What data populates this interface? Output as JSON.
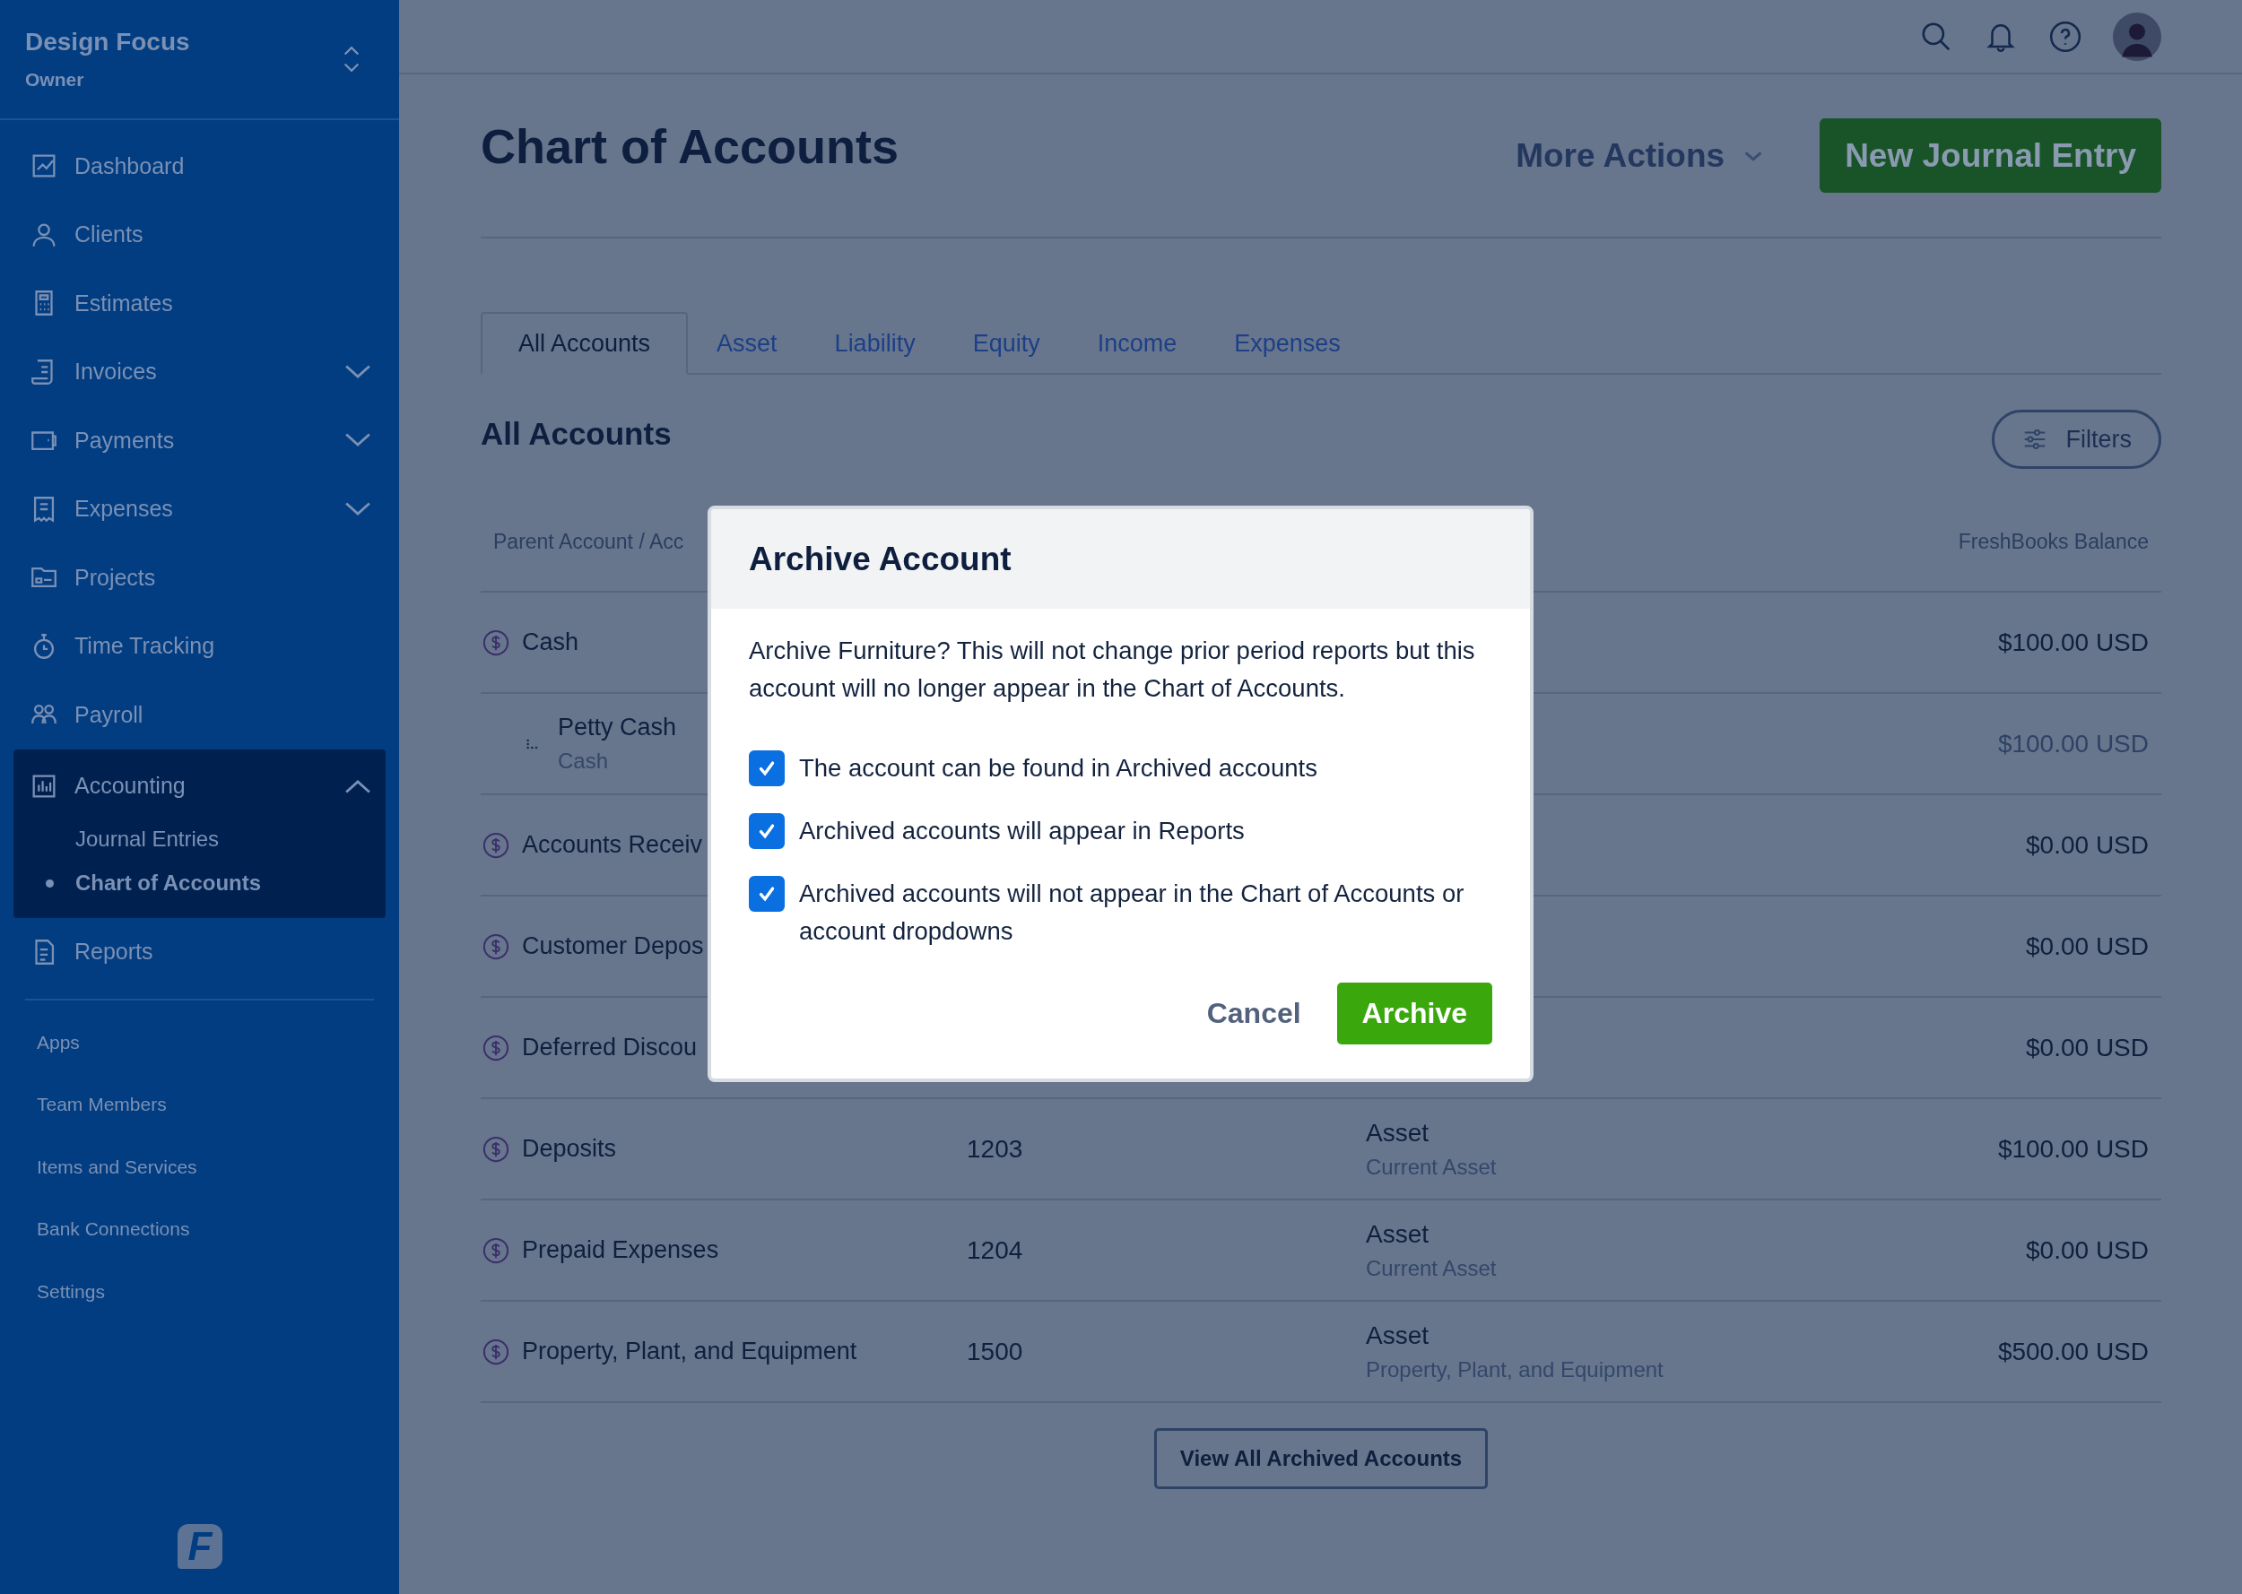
{
  "workspace": {
    "name": "Design Focus",
    "role": "Owner"
  },
  "nav": [
    {
      "label": "Dashboard",
      "kind": "link"
    },
    {
      "label": "Clients",
      "kind": "link"
    },
    {
      "label": "Estimates",
      "kind": "link"
    },
    {
      "label": "Invoices",
      "kind": "group",
      "expanded": false
    },
    {
      "label": "Payments",
      "kind": "group",
      "expanded": false
    },
    {
      "label": "Expenses",
      "kind": "group",
      "expanded": false
    },
    {
      "label": "Projects",
      "kind": "link"
    },
    {
      "label": "Time Tracking",
      "kind": "link"
    },
    {
      "label": "Payroll",
      "kind": "link"
    },
    {
      "label": "Accounting",
      "kind": "group",
      "expanded": true,
      "children": [
        {
          "label": "Journal Entries",
          "selected": false
        },
        {
          "label": "Chart of Accounts",
          "selected": true
        }
      ]
    },
    {
      "label": "Reports",
      "kind": "link"
    }
  ],
  "secondary_nav": [
    "Apps",
    "Team Members",
    "Items and Services",
    "Bank Connections",
    "Settings"
  ],
  "logo": {
    "letter": "F"
  },
  "page": {
    "title": "Chart of Accounts",
    "more_actions": "More Actions",
    "primary_button": "New Journal Entry"
  },
  "tabs": [
    {
      "label": "All Accounts",
      "selected": true
    },
    {
      "label": "Asset",
      "selected": false
    },
    {
      "label": "Liability",
      "selected": false
    },
    {
      "label": "Equity",
      "selected": false
    },
    {
      "label": "Income",
      "selected": false
    },
    {
      "label": "Expenses",
      "selected": false
    }
  ],
  "section_title": "All Accounts",
  "filters_button": "Filters",
  "table": {
    "columns": [
      "Parent Account / Acc",
      "FreshBooks Balance"
    ],
    "rows": [
      {
        "name": "Cash",
        "kind": "parent",
        "balance": "$100.00 USD"
      },
      {
        "name": "Petty Cash",
        "parent": "Cash",
        "kind": "child",
        "balance": "$100.00 USD"
      },
      {
        "name": "Accounts Receiv",
        "kind": "parent",
        "balance": "$0.00 USD"
      },
      {
        "name": "Customer Depos",
        "kind": "parent",
        "balance": "$0.00 USD"
      },
      {
        "name": "Deferred Discou",
        "kind": "parent",
        "balance": "$0.00 USD"
      },
      {
        "name": "Deposits",
        "kind": "parent",
        "number": "1203",
        "type": "Asset",
        "subtype": "Current Asset",
        "balance": "$100.00 USD"
      },
      {
        "name": "Prepaid Expenses",
        "kind": "parent",
        "number": "1204",
        "type": "Asset",
        "subtype": "Current Asset",
        "balance": "$0.00 USD"
      },
      {
        "name": "Property, Plant, and Equipment",
        "kind": "parent",
        "number": "1500",
        "type": "Asset",
        "subtype": "Property, Plant, and Equipment",
        "balance": "$500.00 USD"
      }
    ]
  },
  "archived_button": "View All Archived Accounts",
  "dialog": {
    "title": "Archive Account",
    "message": "Archive Furniture? This will not change prior period reports but this account will no longer appear in the Chart of Accounts.",
    "checks": [
      {
        "label": "The account can be found in Archived accounts",
        "checked": true
      },
      {
        "label": "Archived accounts will appear in Reports",
        "checked": true
      },
      {
        "label": "Archived accounts will not appear in the Chart of Accounts or account dropdowns",
        "checked": true
      }
    ],
    "cancel": "Cancel",
    "confirm": "Archive"
  }
}
